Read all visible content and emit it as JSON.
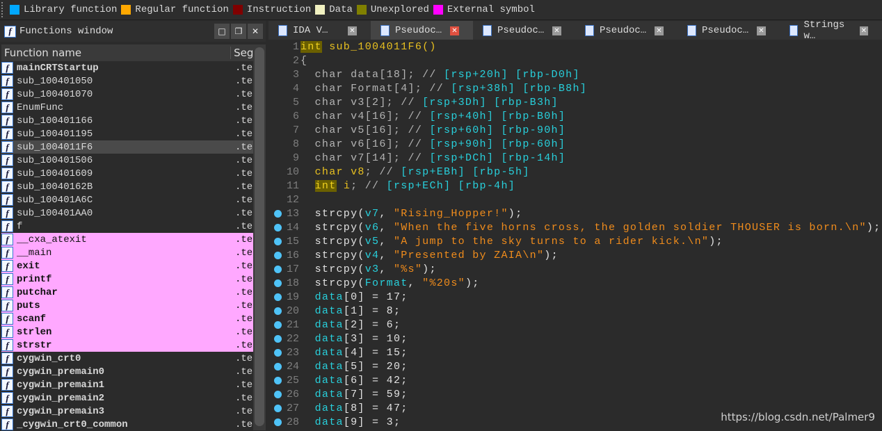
{
  "legend": [
    {
      "label": "Library function",
      "color": "#00a8ff"
    },
    {
      "label": "Regular function",
      "color": "#ffa800"
    },
    {
      "label": "Instruction",
      "color": "#800000"
    },
    {
      "label": "Data",
      "color": "#f0f0c0"
    },
    {
      "label": "Unexplored",
      "color": "#808000"
    },
    {
      "label": "External symbol",
      "color": "#ff00ff"
    }
  ],
  "functions_window": {
    "title": "Functions window",
    "col_name": "Function name",
    "col_segment": "Seg",
    "rows": [
      {
        "name": "mainCRTStartup",
        "seg": ".te",
        "bold": true
      },
      {
        "name": "sub_100401050",
        "seg": ".te"
      },
      {
        "name": "sub_100401070",
        "seg": ".te"
      },
      {
        "name": "EnumFunc",
        "seg": ".te"
      },
      {
        "name": "sub_100401166",
        "seg": ".te"
      },
      {
        "name": "sub_100401195",
        "seg": ".te"
      },
      {
        "name": "sub_1004011F6",
        "seg": ".te",
        "selected": true
      },
      {
        "name": "sub_100401506",
        "seg": ".te"
      },
      {
        "name": "sub_100401609",
        "seg": ".te"
      },
      {
        "name": "sub_10040162B",
        "seg": ".te"
      },
      {
        "name": "sub_100401A6C",
        "seg": ".te"
      },
      {
        "name": "sub_100401AA0",
        "seg": ".te"
      },
      {
        "name": "f",
        "seg": ".te"
      },
      {
        "name": "__cxa_atexit",
        "seg": ".te",
        "ext": true
      },
      {
        "name": "__main",
        "seg": ".te",
        "ext": true
      },
      {
        "name": "exit",
        "seg": ".te",
        "ext": true,
        "bold": true
      },
      {
        "name": "printf",
        "seg": ".te",
        "ext": true,
        "bold": true
      },
      {
        "name": "putchar",
        "seg": ".te",
        "ext": true,
        "bold": true
      },
      {
        "name": "puts",
        "seg": ".te",
        "ext": true,
        "bold": true
      },
      {
        "name": "scanf",
        "seg": ".te",
        "ext": true,
        "bold": true
      },
      {
        "name": "strlen",
        "seg": ".te",
        "ext": true,
        "bold": true
      },
      {
        "name": "strstr",
        "seg": ".te",
        "ext": true,
        "bold": true
      },
      {
        "name": "cygwin_crt0",
        "seg": ".te",
        "bold": true
      },
      {
        "name": "cygwin_premain0",
        "seg": ".te",
        "bold": true
      },
      {
        "name": "cygwin_premain1",
        "seg": ".te",
        "bold": true
      },
      {
        "name": "cygwin_premain2",
        "seg": ".te",
        "bold": true
      },
      {
        "name": "cygwin_premain3",
        "seg": ".te",
        "bold": true
      },
      {
        "name": "_cygwin_crt0_common",
        "seg": ".te",
        "bold": true
      }
    ]
  },
  "tabs": [
    {
      "label": "IDA V…"
    },
    {
      "label": "Pseudoc…",
      "active": true
    },
    {
      "label": "Pseudoc…"
    },
    {
      "label": "Pseudoc…"
    },
    {
      "label": "Pseudoc…"
    },
    {
      "label": "Strings w…"
    }
  ],
  "code": [
    {
      "n": "1",
      "bp": false,
      "seg": [
        [
          "int",
          "k"
        ],
        [
          " sub_1004011F6()",
          "y"
        ]
      ]
    },
    {
      "n": "2",
      "bp": false,
      "seg": [
        [
          "{",
          "g"
        ]
      ]
    },
    {
      "n": "3",
      "bp": false,
      "seg": [
        [
          "  char data[18]; // ",
          "g"
        ],
        [
          "[rsp+20h] [rbp-D0h]",
          "c"
        ]
      ]
    },
    {
      "n": "4",
      "bp": false,
      "seg": [
        [
          "  char Format[4]; // ",
          "g"
        ],
        [
          "[rsp+38h] [rbp-B8h]",
          "c"
        ]
      ]
    },
    {
      "n": "5",
      "bp": false,
      "seg": [
        [
          "  char v3[2]; // ",
          "g"
        ],
        [
          "[rsp+3Dh] [rbp-B3h]",
          "c"
        ]
      ]
    },
    {
      "n": "6",
      "bp": false,
      "seg": [
        [
          "  char v4[16]; // ",
          "g"
        ],
        [
          "[rsp+40h] [rbp-B0h]",
          "c"
        ]
      ]
    },
    {
      "n": "7",
      "bp": false,
      "seg": [
        [
          "  char v5[16]; // ",
          "g"
        ],
        [
          "[rsp+60h] [rbp-90h]",
          "c"
        ]
      ]
    },
    {
      "n": "8",
      "bp": false,
      "seg": [
        [
          "  char v6[16]; // ",
          "g"
        ],
        [
          "[rsp+90h] [rbp-60h]",
          "c"
        ]
      ]
    },
    {
      "n": "9",
      "bp": false,
      "seg": [
        [
          "  char v7[14]; // ",
          "g"
        ],
        [
          "[rsp+DCh] [rbp-14h]",
          "c"
        ]
      ]
    },
    {
      "n": "10",
      "bp": false,
      "seg": [
        [
          "  char v8",
          "y"
        ],
        [
          "; // ",
          "g"
        ],
        [
          "[rsp+EBh] [rbp-5h]",
          "c"
        ]
      ]
    },
    {
      "n": "11",
      "bp": false,
      "seg": [
        [
          "  ",
          "g"
        ],
        [
          "int",
          "k"
        ],
        [
          " i",
          "y"
        ],
        [
          "; // ",
          "g"
        ],
        [
          "[rsp+ECh] [rbp-4h]",
          "c"
        ]
      ]
    },
    {
      "n": "12",
      "bp": false,
      "seg": []
    },
    {
      "n": "13",
      "bp": true,
      "seg": [
        [
          "  strcpy(",
          "w"
        ],
        [
          "v7",
          "c"
        ],
        [
          ", ",
          "w"
        ],
        [
          "\"Rising_Hopper!\"",
          "o"
        ],
        [
          ");",
          "w"
        ]
      ]
    },
    {
      "n": "14",
      "bp": true,
      "seg": [
        [
          "  strcpy(",
          "w"
        ],
        [
          "v6",
          "c"
        ],
        [
          ", ",
          "w"
        ],
        [
          "\"When the five horns cross, the golden soldier THOUSER is born.\\n\"",
          "o"
        ],
        [
          ");",
          "w"
        ]
      ]
    },
    {
      "n": "15",
      "bp": true,
      "seg": [
        [
          "  strcpy(",
          "w"
        ],
        [
          "v5",
          "c"
        ],
        [
          ", ",
          "w"
        ],
        [
          "\"A jump to the sky turns to a rider kick.\\n\"",
          "o"
        ],
        [
          ");",
          "w"
        ]
      ]
    },
    {
      "n": "16",
      "bp": true,
      "seg": [
        [
          "  strcpy(",
          "w"
        ],
        [
          "v4",
          "c"
        ],
        [
          ", ",
          "w"
        ],
        [
          "\"Presented by ZAIA\\n\"",
          "o"
        ],
        [
          ");",
          "w"
        ]
      ]
    },
    {
      "n": "17",
      "bp": true,
      "seg": [
        [
          "  strcpy(",
          "w"
        ],
        [
          "v3",
          "c"
        ],
        [
          ", ",
          "w"
        ],
        [
          "\"%s\"",
          "o"
        ],
        [
          ");",
          "w"
        ]
      ]
    },
    {
      "n": "18",
      "bp": true,
      "seg": [
        [
          "  strcpy(",
          "w"
        ],
        [
          "Format",
          "c"
        ],
        [
          ", ",
          "w"
        ],
        [
          "\"%20s\"",
          "o"
        ],
        [
          ");",
          "w"
        ]
      ]
    },
    {
      "n": "19",
      "bp": true,
      "seg": [
        [
          "  ",
          "w"
        ],
        [
          "data",
          "c"
        ],
        [
          "[0] = 17;",
          "w"
        ]
      ]
    },
    {
      "n": "20",
      "bp": true,
      "seg": [
        [
          "  ",
          "w"
        ],
        [
          "data",
          "c"
        ],
        [
          "[1] = 8;",
          "w"
        ]
      ]
    },
    {
      "n": "21",
      "bp": true,
      "seg": [
        [
          "  ",
          "w"
        ],
        [
          "data",
          "c"
        ],
        [
          "[2] = 6;",
          "w"
        ]
      ]
    },
    {
      "n": "22",
      "bp": true,
      "seg": [
        [
          "  ",
          "w"
        ],
        [
          "data",
          "c"
        ],
        [
          "[3] = 10;",
          "w"
        ]
      ]
    },
    {
      "n": "23",
      "bp": true,
      "seg": [
        [
          "  ",
          "w"
        ],
        [
          "data",
          "c"
        ],
        [
          "[4] = 15;",
          "w"
        ]
      ]
    },
    {
      "n": "24",
      "bp": true,
      "seg": [
        [
          "  ",
          "w"
        ],
        [
          "data",
          "c"
        ],
        [
          "[5] = 20;",
          "w"
        ]
      ]
    },
    {
      "n": "25",
      "bp": true,
      "seg": [
        [
          "  ",
          "w"
        ],
        [
          "data",
          "c"
        ],
        [
          "[6] = 42;",
          "w"
        ]
      ]
    },
    {
      "n": "26",
      "bp": true,
      "seg": [
        [
          "  ",
          "w"
        ],
        [
          "data",
          "c"
        ],
        [
          "[7] = 59;",
          "w"
        ]
      ]
    },
    {
      "n": "27",
      "bp": true,
      "seg": [
        [
          "  ",
          "w"
        ],
        [
          "data",
          "c"
        ],
        [
          "[8] = 47;",
          "w"
        ]
      ]
    },
    {
      "n": "28",
      "bp": true,
      "seg": [
        [
          "  ",
          "w"
        ],
        [
          "data",
          "c"
        ],
        [
          "[9] = 3;",
          "w"
        ]
      ]
    }
  ],
  "watermark": "https://blog.csdn.net/Palmer9"
}
